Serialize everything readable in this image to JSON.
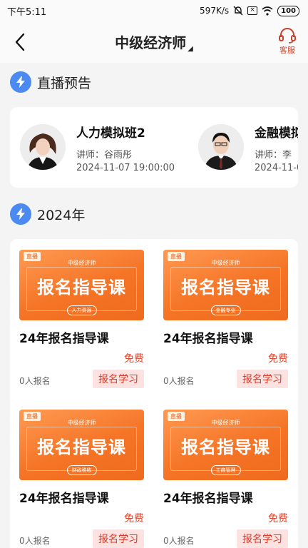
{
  "status": {
    "time": "下午5:11",
    "speed": "597K/s",
    "battery": "100"
  },
  "nav": {
    "title": "中级经济师",
    "service_label": "客服"
  },
  "sections": {
    "live": "直播预告",
    "year": "2024年"
  },
  "live_items": [
    {
      "name": "人力模拟班2",
      "teacher": "讲师：谷雨彤",
      "time": "2024-11-07 19:00:00"
    },
    {
      "name": "金融模拟",
      "teacher": "讲师：李",
      "time": "2024-11-0"
    }
  ],
  "courses": [
    {
      "tag": "直播",
      "sub": "中级经济师",
      "banner": "报名指导课",
      "badge": "人力资源",
      "title": "24年报名指导课",
      "price": "免费",
      "enrolled": "0人报名",
      "button": "报名学习"
    },
    {
      "tag": "直播",
      "sub": "中级经济师",
      "banner": "报名指导课",
      "badge": "金融专业",
      "title": "24年报名指导课",
      "price": "免费",
      "enrolled": "0人报名",
      "button": "报名学习"
    },
    {
      "tag": "直播",
      "sub": "中级经济师",
      "banner": "报名指导课",
      "badge": "财政税收",
      "title": "24年报名指导课",
      "price": "免费",
      "enrolled": "0人报名",
      "button": "报名学习"
    },
    {
      "tag": "直播",
      "sub": "中级经济师",
      "banner": "报名指导课",
      "badge": "工商管理",
      "title": "24年报名指导课",
      "price": "免费",
      "enrolled": "0人报名",
      "button": "报名学习"
    }
  ],
  "colors": {
    "accent_blue": "#4b8af0",
    "accent_red": "#e0462b",
    "banner_orange": "#f57426"
  }
}
